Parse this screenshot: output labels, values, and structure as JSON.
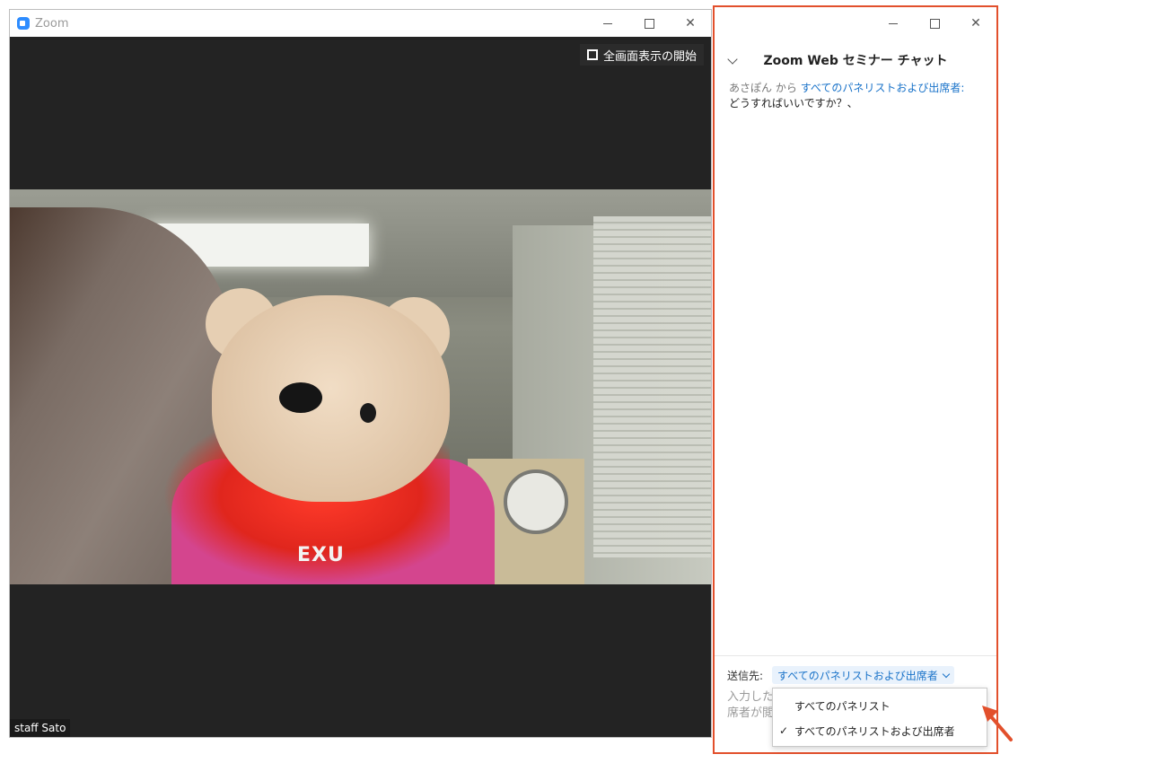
{
  "main_window": {
    "title": "Zoom",
    "fullscreen_label": "全画面表示の開始",
    "participant_name": "staff Sato",
    "video_logo_text": "EXU"
  },
  "chat": {
    "title": "Zoom Web セミナー チャット",
    "messages": [
      {
        "sender": "あさぽん",
        "from_word": "から",
        "to": "すべてのパネリストおよび出席者:",
        "text": "どうすればいいですか？、"
      }
    ],
    "send_to_label": "送信先:",
    "recipient": "すべてのパネリストおよび出席者",
    "input_placeholder": "入力した\n席者が閲",
    "dropdown": {
      "options": [
        {
          "label": "すべてのパネリスト",
          "checked": false
        },
        {
          "label": "すべてのパネリストおよび出席者",
          "checked": true
        }
      ],
      "check_glyph": "✓"
    }
  },
  "colors": {
    "highlight_border": "#e2502c",
    "link_blue": "#1a73c9",
    "zoom_blue": "#2d8cff"
  },
  "icons": {
    "minimize": "minimize-icon",
    "maximize": "maximize-icon",
    "close": "close-icon",
    "close_glyph": "✕"
  }
}
